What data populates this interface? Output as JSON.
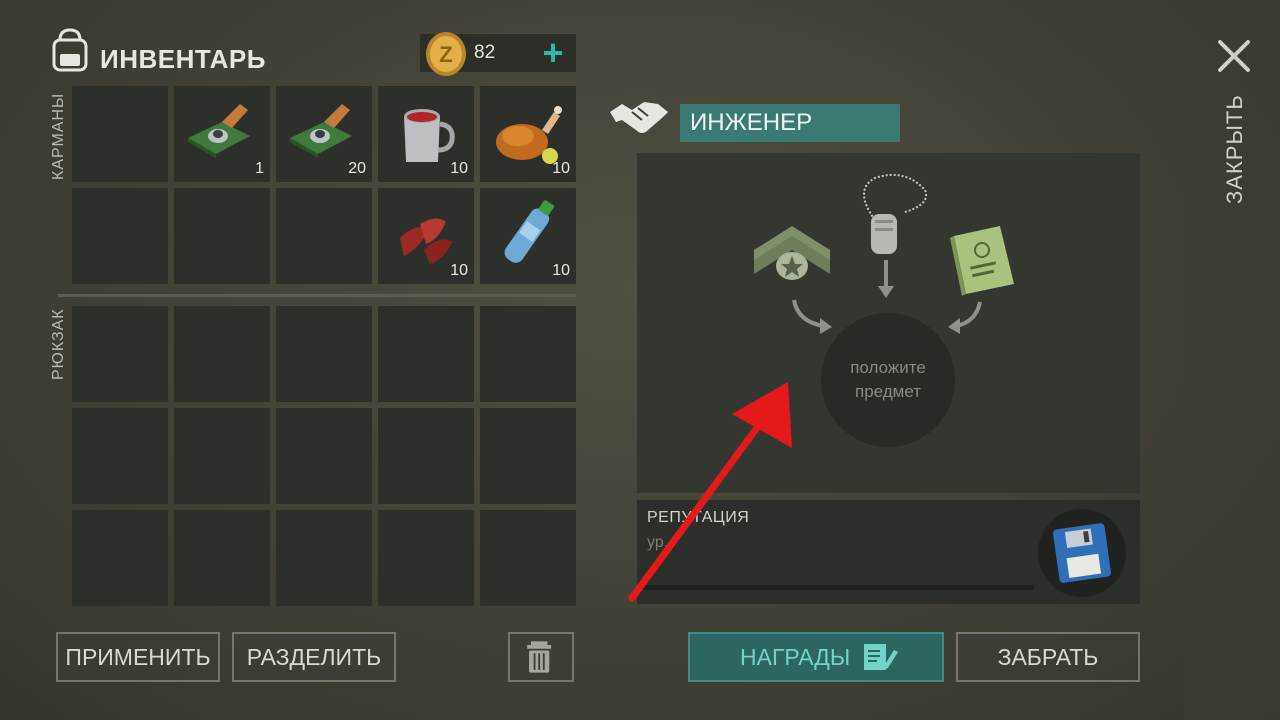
{
  "inventory": {
    "title": "ИНВЕНТАРЬ",
    "coins": "82",
    "plus_label": "+",
    "pockets_label": "КАРМАНЫ",
    "backpack_label": "РЮКЗАК",
    "pockets": [
      {
        "item": "",
        "qty": ""
      },
      {
        "item": "circuit-board-icon",
        "qty": "1"
      },
      {
        "item": "circuit-board-icon",
        "qty": "20"
      },
      {
        "item": "mug-icon",
        "qty": "10"
      },
      {
        "item": "roast-chicken-icon",
        "qty": "10"
      },
      {
        "item": "",
        "qty": ""
      },
      {
        "item": "",
        "qty": ""
      },
      {
        "item": "",
        "qty": ""
      },
      {
        "item": "raw-meat-icon",
        "qty": "10"
      },
      {
        "item": "water-bottle-icon",
        "qty": "10"
      }
    ]
  },
  "buttons": {
    "apply": "ПРИМЕНИТЬ",
    "split": "РАЗДЕЛИТЬ",
    "rewards": "НАГРАДЫ",
    "take": "ЗАБРАТЬ",
    "close": "ЗАКРЫТЬ"
  },
  "trader": {
    "name": "ИНЖЕНЕР",
    "drop_line1": "положите",
    "drop_line2": "предмет",
    "reputation_title": "РЕПУТАЦИЯ",
    "reputation_level": "ур."
  },
  "colors": {
    "accent_teal": "#3a7a73",
    "annotation_red": "#e3191c"
  }
}
